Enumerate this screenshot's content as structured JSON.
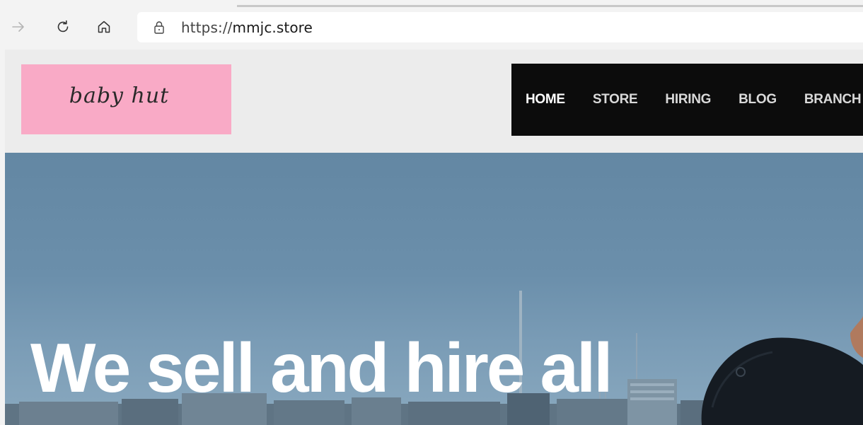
{
  "browser": {
    "url_scheme": "https://",
    "url_host": "mmjc.store",
    "icons": [
      "forward-arrow-icon",
      "refresh-icon",
      "home-icon",
      "lock-icon"
    ]
  },
  "site": {
    "logo_text": "baby hut",
    "logo_color": "#f9aac6",
    "nav_bg_color": "#0c0c0c",
    "nav_items": [
      {
        "label": "HOME",
        "active": true
      },
      {
        "label": "STORE",
        "active": false
      },
      {
        "label": "HIRING",
        "active": false
      },
      {
        "label": "BLOG",
        "active": false
      },
      {
        "label": "BRANCH",
        "active": false
      }
    ]
  },
  "hero": {
    "title_line1": "We sell and hire all",
    "title_line2": ""
  }
}
